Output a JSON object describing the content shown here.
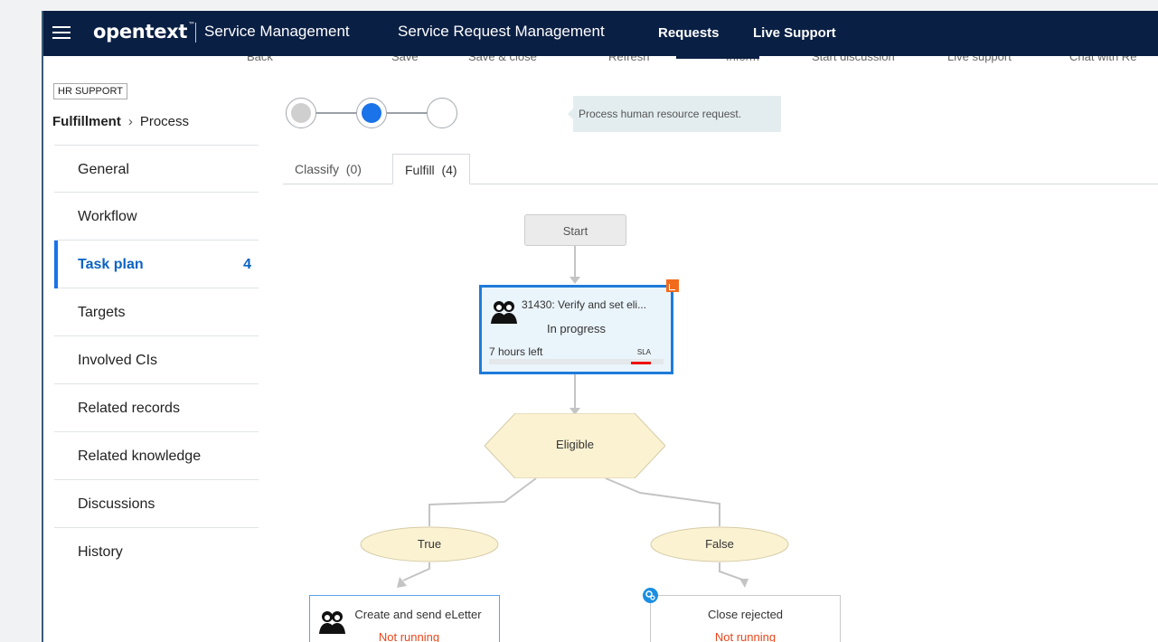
{
  "header": {
    "brand": "opentext",
    "brand_mark": "™",
    "product": "Service Management",
    "nav": [
      "Service Request Management",
      "Requests",
      "Live Support"
    ]
  },
  "toolbar": {
    "labels": [
      "Back",
      "Save",
      "Save & close",
      "Refresh",
      "Inform",
      "Start discussion",
      "Live support",
      "Chat with Re"
    ]
  },
  "record": {
    "category": "HR SUPPORT",
    "phase": "Fulfillment",
    "status": "Process"
  },
  "sidebar": {
    "items": [
      {
        "label": "General",
        "badge": ""
      },
      {
        "label": "Workflow",
        "badge": ""
      },
      {
        "label": "Task plan",
        "badge": "4"
      },
      {
        "label": "Targets",
        "badge": ""
      },
      {
        "label": "Involved CIs",
        "badge": ""
      },
      {
        "label": "Related records",
        "badge": ""
      },
      {
        "label": "Related knowledge",
        "badge": ""
      },
      {
        "label": "Discussions",
        "badge": ""
      },
      {
        "label": "History",
        "badge": ""
      }
    ],
    "active_index": 2
  },
  "workflow_stage": {
    "current_stage": 2,
    "total_stages": 3,
    "hint": "Process human resource request.",
    "colors": {
      "done": "#cfcfcf",
      "current": "#1a73e8"
    }
  },
  "tabs": [
    {
      "label": "Classify",
      "count": "(0)"
    },
    {
      "label": "Fulfill",
      "count": "(4)"
    }
  ],
  "task_plan": {
    "start": "Start",
    "current_task": {
      "title": "31430: Verify and set eli...",
      "status": "In progress",
      "time_left": "7 hours left",
      "sla": "SLA"
    },
    "decision": "Eligible",
    "branches": [
      "True",
      "False"
    ],
    "next_tasks": [
      {
        "title": "Create and send eLetter",
        "status": "Not running",
        "icon": "people-icon"
      },
      {
        "title": "Close rejected",
        "status": "Not running",
        "icon": "gear-icon"
      }
    ]
  }
}
